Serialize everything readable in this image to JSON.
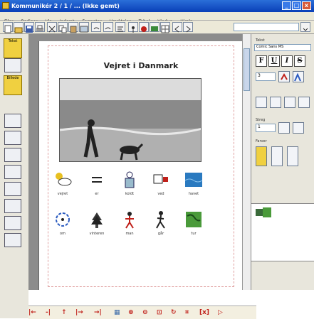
{
  "window": {
    "title": "Kommunikér 2 / 1 / ... (Ikke gemt)",
    "controls": [
      "_",
      "□",
      "x"
    ]
  },
  "menu": [
    "Filer",
    "Rediger",
    "Vis",
    "Indsæt",
    "Formater",
    "Værktøjer",
    "Tabel",
    "Vindue",
    "Hjælp"
  ],
  "toolbar": {
    "zoom_value": ""
  },
  "left_toolbar": {
    "tab1": "Tekst",
    "tab2": "Billede"
  },
  "document": {
    "title": "Vejret i Danmark",
    "row1": [
      {
        "word": "vejret",
        "icon": "sun-cloud-icon"
      },
      {
        "word": "er",
        "icon": "equals-icon"
      },
      {
        "word": "koldt",
        "icon": "cold-person-icon"
      },
      {
        "word": "ved",
        "icon": "sign-icon"
      },
      {
        "word": "havet",
        "icon": "sea-icon"
      }
    ],
    "row2": [
      {
        "word": "om",
        "icon": "circle-arrow-icon"
      },
      {
        "word": "vinteren",
        "icon": "tree-icon"
      },
      {
        "word": "man",
        "icon": "person-icon"
      },
      {
        "word": "går",
        "icon": "walking-icon"
      },
      {
        "word": "tur",
        "icon": "map-icon"
      }
    ]
  },
  "right_panel": {
    "font_label": "Tekst",
    "font_value": "Comic Sans MS",
    "format_buttons": [
      "F",
      "U",
      "I",
      "S"
    ],
    "size_value": "3",
    "size_label": "Streg",
    "border_value": "1",
    "colors_label": "Farver"
  },
  "colors": {
    "title_bar": "#0a3fb8",
    "accent_red": "#c0201a",
    "panel_bg": "#e8e6dc"
  }
}
